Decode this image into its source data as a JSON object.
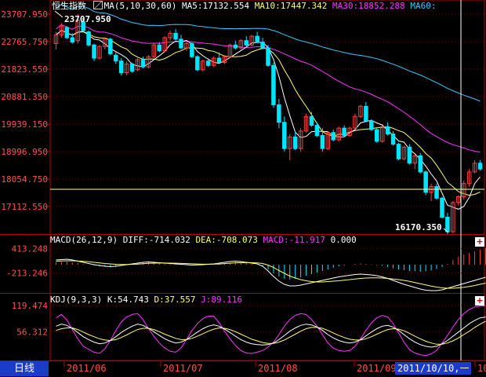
{
  "colors": {
    "bg": "#000000",
    "frame": "#b50000",
    "grid": "#7a0000",
    "axis_text": "#ff5050",
    "up": "#ff4040",
    "down": "#00e5ff",
    "ma5": "#ffffff",
    "ma10": "#ffff66",
    "ma30": "#ff33ff",
    "ma60": "#33ccff",
    "crosshair": "#ffffff"
  },
  "header": {
    "title": "恒生指数",
    "ma_label": "MA(5,10,30,60)",
    "ma5": "MA5:17132.554",
    "ma10": "MA10:17447.342",
    "ma30": "MA30:18852.288",
    "ma60": "MA60:"
  },
  "macd_header": {
    "label": "MACD(26,12,9)",
    "diff": "DIFF:-714.032",
    "dea": "DEA:-708.073",
    "macd": "MACD:-11.917",
    "zero": "0.000"
  },
  "kdj_header": {
    "label": "KDJ(9,3,3)",
    "k": "K:54.743",
    "d": "D:37.557",
    "j": "J:89.116"
  },
  "annotations": {
    "high": "23707.950",
    "low": "16170.350"
  },
  "footer": {
    "period_button": "日线",
    "cursor_date": "2011/10/10,一",
    "months": [
      "2011/06",
      "2011/07",
      "2011/08",
      "2011/09",
      "10"
    ]
  },
  "chart_data": [
    {
      "type": "candlestick",
      "title": "恒生指数",
      "ylim": [
        16170.35,
        23707.95
      ],
      "y_ticks": [
        "23707.950",
        "22765.750",
        "21823.550",
        "20881.350",
        "19939.150",
        "18996.950",
        "18054.750",
        "17112.550"
      ],
      "y_tick_values": [
        23707.95,
        22765.75,
        21823.55,
        20881.35,
        19939.15,
        18996.95,
        18054.75,
        17112.55
      ],
      "x_range": [
        "2011/05",
        "2011/10"
      ],
      "high": 23707.95,
      "low": 16170.35,
      "candles": [
        {
          "o": 22700,
          "h": 23100,
          "l": 22500,
          "c": 23000
        },
        {
          "o": 23000,
          "h": 23400,
          "l": 22900,
          "c": 23300
        },
        {
          "o": 23250,
          "h": 23300,
          "l": 22850,
          "c": 22900
        },
        {
          "o": 22900,
          "h": 23050,
          "l": 22700,
          "c": 22750
        },
        {
          "o": 22800,
          "h": 23707.95,
          "l": 22700,
          "c": 23500
        },
        {
          "o": 23450,
          "h": 23550,
          "l": 23100,
          "c": 23150
        },
        {
          "o": 23100,
          "h": 23150,
          "l": 22600,
          "c": 22650
        },
        {
          "o": 22650,
          "h": 22700,
          "l": 22100,
          "c": 22200
        },
        {
          "o": 22200,
          "h": 22650,
          "l": 22150,
          "c": 22600
        },
        {
          "o": 22600,
          "h": 22900,
          "l": 22500,
          "c": 22850
        },
        {
          "o": 22850,
          "h": 22900,
          "l": 22300,
          "c": 22350
        },
        {
          "o": 22300,
          "h": 22400,
          "l": 22000,
          "c": 22100
        },
        {
          "o": 22100,
          "h": 22200,
          "l": 21600,
          "c": 21700
        },
        {
          "o": 21700,
          "h": 22100,
          "l": 21600,
          "c": 22000
        },
        {
          "o": 22000,
          "h": 22050,
          "l": 21700,
          "c": 21750
        },
        {
          "o": 21800,
          "h": 22200,
          "l": 21750,
          "c": 22150
        },
        {
          "o": 22150,
          "h": 22250,
          "l": 21850,
          "c": 21900
        },
        {
          "o": 21900,
          "h": 22300,
          "l": 21850,
          "c": 22250
        },
        {
          "o": 22250,
          "h": 22700,
          "l": 22200,
          "c": 22650
        },
        {
          "o": 22650,
          "h": 22750,
          "l": 22400,
          "c": 22450
        },
        {
          "o": 22450,
          "h": 22950,
          "l": 22400,
          "c": 22900
        },
        {
          "o": 22900,
          "h": 23150,
          "l": 22800,
          "c": 23050
        },
        {
          "o": 23050,
          "h": 23200,
          "l": 22800,
          "c": 22850
        },
        {
          "o": 22850,
          "h": 23000,
          "l": 22500,
          "c": 22550
        },
        {
          "o": 22550,
          "h": 22750,
          "l": 22450,
          "c": 22700
        },
        {
          "o": 22700,
          "h": 22750,
          "l": 22200,
          "c": 22250
        },
        {
          "o": 22250,
          "h": 22300,
          "l": 21750,
          "c": 21800
        },
        {
          "o": 21800,
          "h": 22150,
          "l": 21750,
          "c": 22100
        },
        {
          "o": 22100,
          "h": 22200,
          "l": 21900,
          "c": 21950
        },
        {
          "o": 21950,
          "h": 22250,
          "l": 21900,
          "c": 22200
        },
        {
          "o": 22200,
          "h": 22400,
          "l": 22000,
          "c": 22050
        },
        {
          "o": 22050,
          "h": 22300,
          "l": 22000,
          "c": 22250
        },
        {
          "o": 22250,
          "h": 22700,
          "l": 22200,
          "c": 22650
        },
        {
          "o": 22650,
          "h": 22800,
          "l": 22500,
          "c": 22550
        },
        {
          "o": 22550,
          "h": 22850,
          "l": 22500,
          "c": 22800
        },
        {
          "o": 22800,
          "h": 22950,
          "l": 22600,
          "c": 22650
        },
        {
          "o": 22650,
          "h": 23000,
          "l": 22600,
          "c": 22950
        },
        {
          "o": 22950,
          "h": 23100,
          "l": 22700,
          "c": 22750
        },
        {
          "o": 22750,
          "h": 22900,
          "l": 22500,
          "c": 22550
        },
        {
          "o": 22550,
          "h": 22650,
          "l": 21900,
          "c": 21950
        },
        {
          "o": 21950,
          "h": 22050,
          "l": 20500,
          "c": 20600
        },
        {
          "o": 20600,
          "h": 20800,
          "l": 19800,
          "c": 20000
        },
        {
          "o": 20000,
          "h": 20200,
          "l": 19000,
          "c": 19100
        },
        {
          "o": 19100,
          "h": 19600,
          "l": 18700,
          "c": 19500
        },
        {
          "o": 19500,
          "h": 19700,
          "l": 19050,
          "c": 19100
        },
        {
          "o": 19100,
          "h": 19800,
          "l": 19000,
          "c": 19700
        },
        {
          "o": 19700,
          "h": 20300,
          "l": 19650,
          "c": 20200
        },
        {
          "o": 20200,
          "h": 20350,
          "l": 19850,
          "c": 19900
        },
        {
          "o": 19900,
          "h": 20000,
          "l": 19500,
          "c": 19550
        },
        {
          "o": 19550,
          "h": 19800,
          "l": 19000,
          "c": 19100
        },
        {
          "o": 19100,
          "h": 19700,
          "l": 19050,
          "c": 19650
        },
        {
          "o": 19650,
          "h": 19750,
          "l": 19350,
          "c": 19400
        },
        {
          "o": 19400,
          "h": 19850,
          "l": 19350,
          "c": 19800
        },
        {
          "o": 19800,
          "h": 19900,
          "l": 19500,
          "c": 19550
        },
        {
          "o": 19550,
          "h": 19850,
          "l": 19500,
          "c": 19800
        },
        {
          "o": 19800,
          "h": 20300,
          "l": 19750,
          "c": 20200
        },
        {
          "o": 20200,
          "h": 20600,
          "l": 20150,
          "c": 20550
        },
        {
          "o": 20550,
          "h": 20700,
          "l": 20000,
          "c": 20050
        },
        {
          "o": 20050,
          "h": 20100,
          "l": 19700,
          "c": 19750
        },
        {
          "o": 19750,
          "h": 19800,
          "l": 19300,
          "c": 19350
        },
        {
          "o": 19350,
          "h": 19900,
          "l": 19300,
          "c": 19850
        },
        {
          "o": 19850,
          "h": 20000,
          "l": 19550,
          "c": 19600
        },
        {
          "o": 19600,
          "h": 19700,
          "l": 19200,
          "c": 19250
        },
        {
          "o": 19250,
          "h": 19300,
          "l": 18700,
          "c": 18750
        },
        {
          "o": 18750,
          "h": 19200,
          "l": 18700,
          "c": 19150
        },
        {
          "o": 19150,
          "h": 19250,
          "l": 18550,
          "c": 18600
        },
        {
          "o": 18600,
          "h": 18900,
          "l": 18400,
          "c": 18850
        },
        {
          "o": 18850,
          "h": 18950,
          "l": 18250,
          "c": 18300
        },
        {
          "o": 18300,
          "h": 18350,
          "l": 17500,
          "c": 17600
        },
        {
          "o": 17600,
          "h": 17900,
          "l": 17300,
          "c": 17800
        },
        {
          "o": 17800,
          "h": 17900,
          "l": 17350,
          "c": 17400
        },
        {
          "o": 17400,
          "h": 17450,
          "l": 16700,
          "c": 16750
        },
        {
          "o": 16750,
          "h": 16900,
          "l": 16170.35,
          "c": 16250
        },
        {
          "o": 16250,
          "h": 17300,
          "l": 16200,
          "c": 17250
        },
        {
          "o": 17250,
          "h": 17500,
          "l": 17150,
          "c": 17450
        },
        {
          "o": 17450,
          "h": 18000,
          "l": 17350,
          "c": 17900
        },
        {
          "o": 17900,
          "h": 18400,
          "l": 17800,
          "c": 18300
        },
        {
          "o": 18300,
          "h": 18700,
          "l": 18250,
          "c": 18600
        },
        {
          "o": 18600,
          "h": 18700,
          "l": 18350,
          "c": 18400
        }
      ]
    },
    {
      "type": "bar",
      "title": "MACD(26,12,9)",
      "y_ticks": [
        "413.248",
        "-213.246"
      ],
      "y_tick_values": [
        413.248,
        -213.246
      ],
      "ylim": [
        -700,
        500
      ],
      "histogram": [
        60,
        70,
        80,
        60,
        40,
        20,
        0,
        -20,
        -40,
        -50,
        -40,
        -30,
        -10,
        10,
        30,
        40,
        50,
        60,
        50,
        40,
        30,
        20,
        10,
        0,
        -10,
        -20,
        -10,
        0,
        10,
        20,
        30,
        40,
        50,
        60,
        50,
        40,
        20,
        0,
        -40,
        -120,
        -220,
        -300,
        -360,
        -380,
        -360,
        -320,
        -280,
        -240,
        -200,
        -160,
        -120,
        -80,
        -40,
        -20,
        0,
        20,
        30,
        20,
        10,
        -10,
        -30,
        -60,
        -90,
        -120,
        -140,
        -160,
        -170,
        -180,
        -170,
        -150,
        -110,
        -60,
        20,
        120,
        200,
        260,
        300,
        340,
        380,
        420
      ],
      "series": [
        {
          "name": "DIFF",
          "values": [
            120,
            130,
            140,
            120,
            90,
            60,
            30,
            0,
            -20,
            -40,
            -50,
            -40,
            -20,
            0,
            20,
            40,
            60,
            70,
            60,
            50,
            40,
            30,
            20,
            10,
            0,
            -10,
            -5,
            0,
            10,
            20,
            40,
            60,
            80,
            90,
            80,
            60,
            40,
            20,
            -40,
            -160,
            -300,
            -420,
            -500,
            -540,
            -540,
            -520,
            -490,
            -460,
            -430,
            -400,
            -370,
            -340,
            -310,
            -290,
            -270,
            -250,
            -240,
            -250,
            -260,
            -280,
            -310,
            -350,
            -400,
            -450,
            -500,
            -540,
            -580,
            -620,
            -650,
            -660,
            -660,
            -640,
            -600,
            -560,
            -520,
            -480,
            -440,
            -400,
            -360,
            -320
          ]
        },
        {
          "name": "DEA",
          "values": [
            90,
            95,
            100,
            100,
            95,
            85,
            75,
            60,
            45,
            30,
            20,
            10,
            5,
            5,
            10,
            15,
            25,
            35,
            40,
            42,
            42,
            40,
            37,
            33,
            28,
            22,
            17,
            13,
            12,
            14,
            19,
            27,
            37,
            47,
            53,
            55,
            52,
            46,
            30,
            -10,
            -70,
            -150,
            -220,
            -290,
            -340,
            -380,
            -410,
            -430,
            -440,
            -440,
            -430,
            -420,
            -410,
            -395,
            -380,
            -365,
            -350,
            -340,
            -335,
            -335,
            -340,
            -350,
            -365,
            -380,
            -400,
            -425,
            -455,
            -485,
            -515,
            -545,
            -570,
            -590,
            -600,
            -600,
            -590,
            -575,
            -555,
            -530,
            -500,
            -470
          ]
        }
      ]
    },
    {
      "type": "line",
      "title": "KDJ(9,3,3)",
      "y_ticks": [
        "119.474",
        "56.312"
      ],
      "y_tick_values": [
        119.474,
        56.312
      ],
      "ylim": [
        -10,
        125
      ],
      "series": [
        {
          "name": "K",
          "values": [
            70,
            75,
            72,
            65,
            55,
            45,
            38,
            32,
            28,
            30,
            36,
            45,
            55,
            63,
            70,
            75,
            72,
            65,
            57,
            48,
            40,
            34,
            30,
            32,
            38,
            47,
            56,
            64,
            70,
            73,
            70,
            63,
            55,
            46,
            38,
            32,
            28,
            26,
            25,
            26,
            30,
            38,
            48,
            58,
            66,
            72,
            75,
            73,
            68,
            60,
            50,
            42,
            36,
            32,
            30,
            32,
            38,
            47,
            56,
            64,
            70,
            72,
            68,
            60,
            50,
            40,
            32,
            26,
            22,
            20,
            22,
            28,
            36,
            46,
            56,
            66,
            76,
            84,
            90,
            92
          ]
        },
        {
          "name": "D",
          "values": [
            60,
            64,
            66,
            66,
            62,
            56,
            50,
            45,
            40,
            37,
            36,
            38,
            43,
            49,
            56,
            62,
            65,
            65,
            62,
            57,
            51,
            46,
            41,
            38,
            38,
            41,
            46,
            52,
            58,
            63,
            66,
            65,
            62,
            57,
            51,
            45,
            39,
            35,
            31,
            29,
            29,
            32,
            37,
            44,
            51,
            58,
            64,
            67,
            67,
            65,
            60,
            54,
            48,
            43,
            39,
            37,
            37,
            40,
            45,
            51,
            57,
            62,
            64,
            63,
            59,
            53,
            46,
            40,
            34,
            30,
            27,
            27,
            30,
            35,
            42,
            50,
            58,
            67,
            75,
            82
          ]
        },
        {
          "name": "J",
          "values": [
            90,
            98,
            85,
            62,
            40,
            22,
            15,
            8,
            5,
            16,
            36,
            60,
            80,
            92,
            98,
            100,
            86,
            64,
            46,
            30,
            18,
            10,
            8,
            18,
            38,
            60,
            76,
            88,
            94,
            94,
            78,
            58,
            40,
            24,
            12,
            6,
            5,
            8,
            12,
            20,
            32,
            50,
            70,
            86,
            96,
            100,
            98,
            86,
            70,
            50,
            30,
            18,
            12,
            10,
            12,
            22,
            40,
            60,
            78,
            90,
            96,
            92,
            76,
            54,
            32,
            14,
            6,
            2,
            0,
            4,
            12,
            30,
            48,
            68,
            86,
            100,
            110,
            116,
            118,
            119
          ]
        }
      ]
    }
  ]
}
